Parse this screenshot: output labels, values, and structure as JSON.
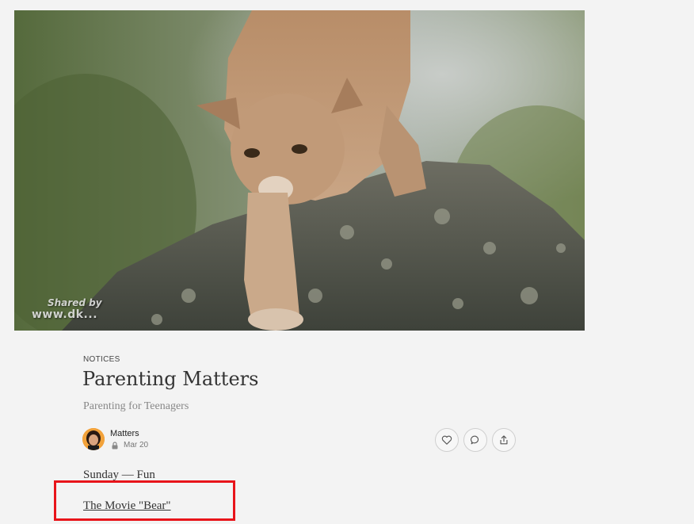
{
  "hero": {
    "image_alt": "Mountain lion walking down a mossy rock",
    "watermark_top": "Shared by",
    "watermark_bottom": "www.dk..."
  },
  "article": {
    "category": "NOTICES",
    "title": "Parenting Matters",
    "subtitle": "Parenting for Teenagers",
    "author": "Matters",
    "date": "Mar 20",
    "lines": [
      "Sunday — Fun",
      "The Movie \"Bear\""
    ]
  },
  "actions": {
    "like_icon": "heart-icon",
    "comment_icon": "comment-icon",
    "share_icon": "share-icon"
  },
  "colors": {
    "background": "#f3f3f3",
    "highlight": "#e8141a",
    "text": "#333333",
    "muted": "#888888"
  }
}
